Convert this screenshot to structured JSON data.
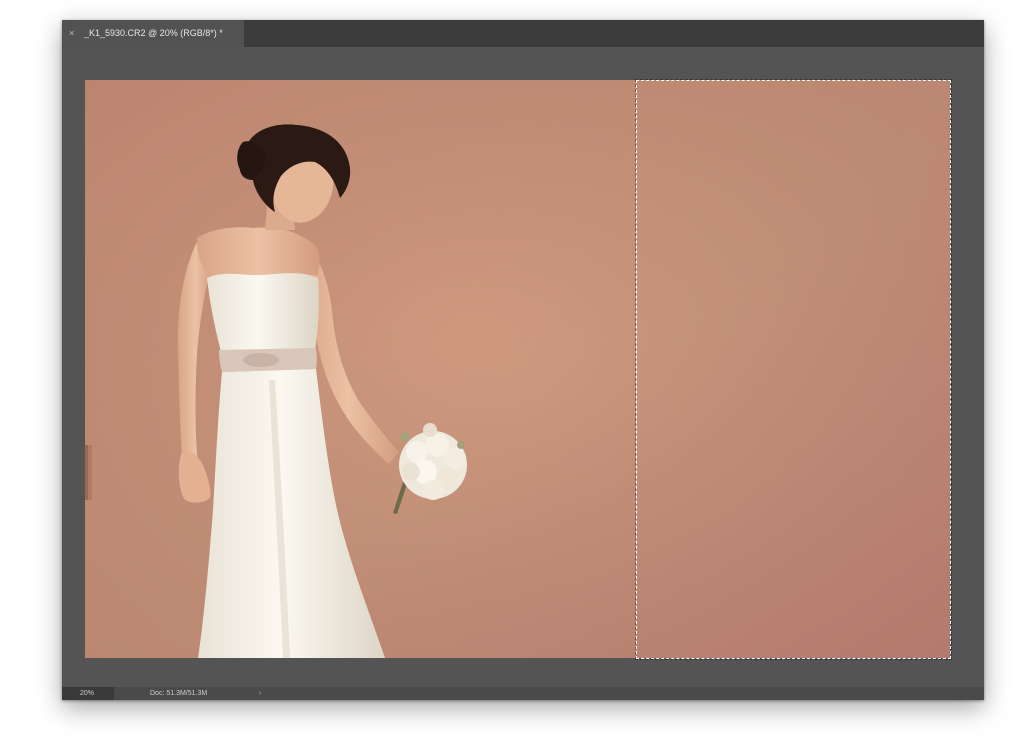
{
  "tab": {
    "title": "_K1_5930.CR2 @ 20% (RGB/8*) *",
    "close_glyph": "×"
  },
  "status": {
    "zoom": "20%",
    "doc_info": "Doc: 51.3M/51.3M",
    "arrow_glyph": "›"
  },
  "colors": {
    "wall": "#c99078",
    "dress": "#f3efe6",
    "hair": "#2b1a14",
    "skin": "#e2b394"
  }
}
